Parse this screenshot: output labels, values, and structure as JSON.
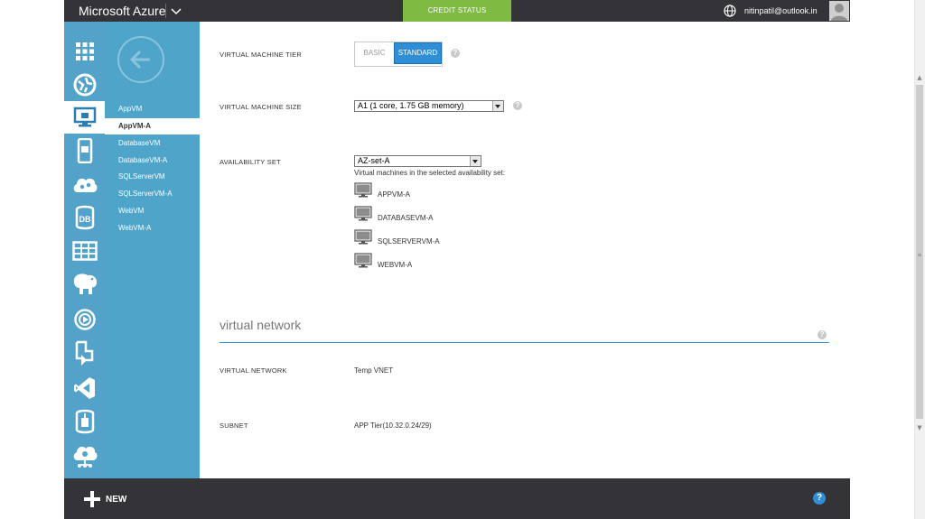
{
  "topbar": {
    "brand": "Microsoft Azure",
    "credit_status": "CREDIT STATUS",
    "account": "nitinpatil@outlook.in"
  },
  "sidebar": {
    "icons": [
      "all-items-grid-icon",
      "web-sites-icon",
      "virtual-machines-icon",
      "mobile-services-icon",
      "cloud-services-icon",
      "sql-databases-icon",
      "storage-icon",
      "hdinsight-icon",
      "media-services-icon",
      "service-bus-icon",
      "visual-studio-icon",
      "cache-icon",
      "networks-icon"
    ],
    "active_icon": "virtual-machines-icon"
  },
  "vm_list": {
    "items": [
      "AppVM",
      "AppVM-A",
      "DatabaseVM",
      "DatabaseVM-A",
      "SQLServerVM",
      "SQLServerVM-A",
      "WebVM",
      "WebVM-A"
    ],
    "selected": "AppVM-A"
  },
  "form": {
    "tier": {
      "label": "VIRTUAL MACHINE TIER",
      "options": [
        "BASIC",
        "STANDARD"
      ],
      "selected": "STANDARD"
    },
    "size": {
      "label": "VIRTUAL MACHINE SIZE",
      "value": "A1 (1 core, 1.75 GB memory)"
    },
    "availability_set": {
      "label": "AVAILABILITY SET",
      "value": "AZ-set-A",
      "note": "Virtual machines in the selected availability set:",
      "vms": [
        "APPVM-A",
        "DATABASEVM-A",
        "SQLSERVERVM-A",
        "WEBVM-A"
      ]
    }
  },
  "network_section": {
    "title": "virtual network",
    "virtual_network": {
      "label": "VIRTUAL NETWORK",
      "value": "Temp VNET"
    },
    "subnet": {
      "label": "SUBNET",
      "value": "APP Tier(10.32.0.24/29)"
    }
  },
  "bottombar": {
    "new_label": "NEW",
    "help_symbol": "?"
  },
  "colors": {
    "accent": "#2e8fd6",
    "sidebar": "#53a2c9",
    "topbar": "#333338",
    "credit": "#7fba42"
  }
}
